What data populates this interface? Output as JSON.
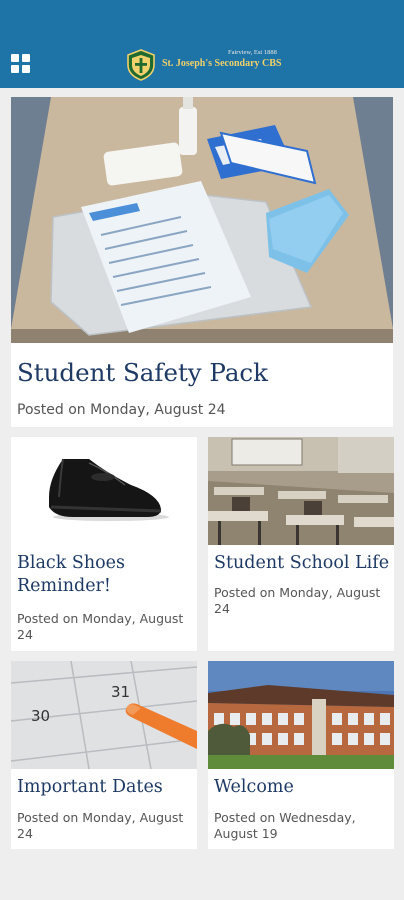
{
  "header": {
    "school_name": "St. Joseph's Secondary CBS",
    "tagline": "Fairview, Est 1888",
    "brand_color": "#1f74a7",
    "menu_icon": "grid-menu-icon",
    "crest_icon": "school-crest-icon"
  },
  "featured": {
    "title": "Student Safety Pack",
    "posted": "Posted on Monday, August 24"
  },
  "posts": [
    {
      "title": "Black Shoes Reminder!",
      "posted": "Posted on Monday, August 24"
    },
    {
      "title": "Student School Life",
      "posted": "Posted on Monday, August 24"
    },
    {
      "title": "Important Dates",
      "posted": "Posted on Monday, August 24"
    },
    {
      "title": "Welcome",
      "posted": "Posted on Wednesday, August 19"
    }
  ],
  "calendar_numbers": {
    "a": "30",
    "b": "31"
  }
}
